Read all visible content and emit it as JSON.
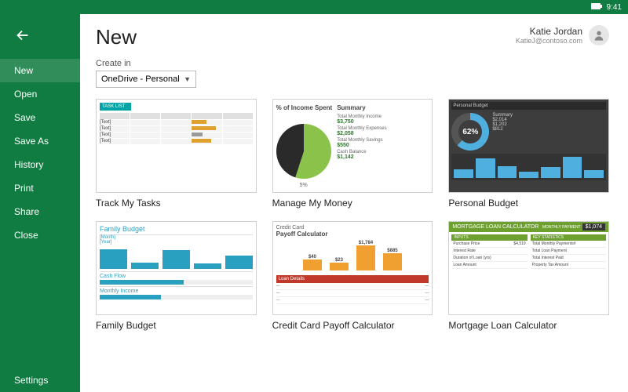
{
  "status_bar": {
    "time": "9:41"
  },
  "sidebar": {
    "items": [
      {
        "label": "New",
        "active": true
      },
      {
        "label": "Open"
      },
      {
        "label": "Save"
      },
      {
        "label": "Save As"
      },
      {
        "label": "History"
      },
      {
        "label": "Print"
      },
      {
        "label": "Share"
      },
      {
        "label": "Close"
      }
    ],
    "settings_label": "Settings"
  },
  "header": {
    "title": "New",
    "user_name": "Katie Jordan",
    "user_email": "KatieJ@contoso.com"
  },
  "create": {
    "label": "Create in",
    "selected": "OneDrive - Personal"
  },
  "templates": [
    {
      "title": "Track My Tasks"
    },
    {
      "title": "Manage My Money"
    },
    {
      "title": "Personal Budget"
    },
    {
      "title": "Family Budget"
    },
    {
      "title": "Credit Card Payoff Calculator"
    },
    {
      "title": "Mortgage Loan Calculator"
    }
  ],
  "thumbs": {
    "tasks": {
      "header": "TASK LIST",
      "placeholder": "[Text]"
    },
    "money": {
      "pie_label": "5%",
      "col1": "% of Income Spent",
      "col2": "Summary",
      "rows": [
        {
          "label": "Total Monthly Income",
          "value": "$3,750"
        },
        {
          "label": "Total Monthly Expenses",
          "value": "$2,058"
        },
        {
          "label": "Total Monthly Savings",
          "value": "$550"
        },
        {
          "label": "Cash Balance",
          "value": "$1,142"
        }
      ]
    },
    "pbudget": {
      "header": "Personal Budget",
      "donut_pct": "62%",
      "summary_label": "Summary",
      "stats": [
        "$2,014",
        "$1,202",
        "$812"
      ]
    },
    "fbudget": {
      "title": "Family Budget",
      "month": "[Month]",
      "year": "[Year]",
      "section2": "Cash Flow",
      "section3": "Monthly Income"
    },
    "ccard": {
      "sub": "Credit Card",
      "title": "Payoff Calculator",
      "bars": [
        {
          "value": "$40",
          "h": 14
        },
        {
          "value": "$23",
          "h": 10
        },
        {
          "value": "$1,784",
          "h": 32
        },
        {
          "value": "$885",
          "h": 22
        }
      ],
      "loan_header": "Loan Details"
    },
    "mortgage": {
      "title": "MORTGAGE LOAN CALCULATOR",
      "monthly_label": "MONTHLY PAYMENT",
      "monthly_value": "$1,074",
      "left_h": "INPUTS",
      "right_h": "KEY STATISTICS",
      "left_rows": [
        {
          "l": "Purchase Price",
          "v": "$4,519"
        },
        {
          "l": "Interest Rate",
          "v": ""
        },
        {
          "l": "Duration of Loan (yrs)",
          "v": ""
        },
        {
          "l": "Loan Amount",
          "v": ""
        }
      ],
      "right_rows": [
        {
          "l": "Total Monthly Payments#",
          "v": ""
        },
        {
          "l": "Total Loan Payment",
          "v": ""
        },
        {
          "l": "Total Interest Paid",
          "v": ""
        },
        {
          "l": "Property Tax Amount",
          "v": ""
        }
      ]
    }
  }
}
